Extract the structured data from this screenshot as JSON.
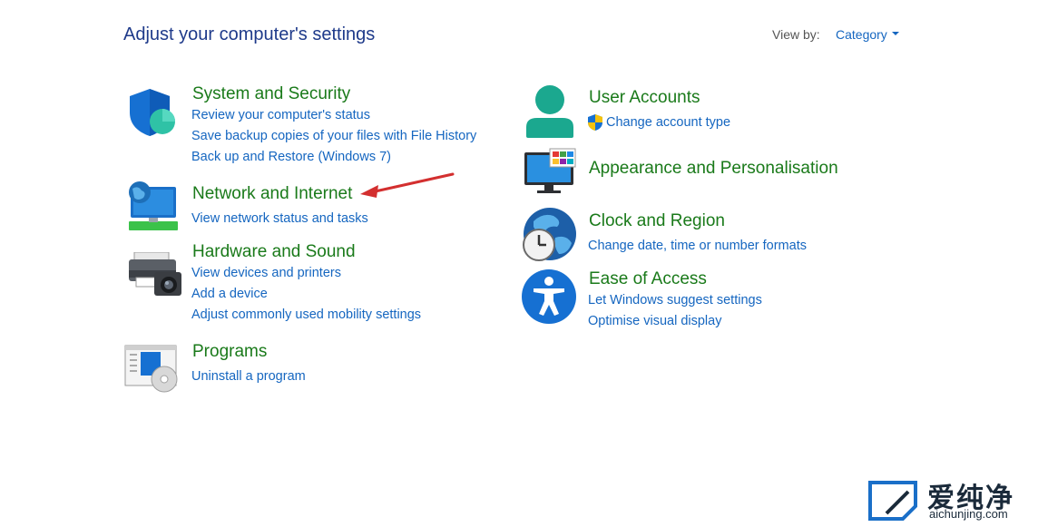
{
  "page": {
    "title": "Adjust your computer's settings",
    "view_by_label": "View by:",
    "view_by_value": "Category"
  },
  "left_categories": [
    {
      "name": "System and Security",
      "links": [
        "Review your computer's status",
        "Save backup copies of your files with File History",
        "Back up and Restore (Windows 7)"
      ]
    },
    {
      "name": "Network and Internet",
      "links": [
        "View network status and tasks"
      ]
    },
    {
      "name": "Hardware and Sound",
      "links": [
        "View devices and printers",
        "Add a device",
        "Adjust commonly used mobility settings"
      ]
    },
    {
      "name": "Programs",
      "links": [
        "Uninstall a program"
      ]
    }
  ],
  "right_categories": [
    {
      "name": "User Accounts",
      "links": [
        "Change account type"
      ]
    },
    {
      "name": "Appearance and Personalisation",
      "links": []
    },
    {
      "name": "Clock and Region",
      "links": [
        "Change date, time or number formats"
      ]
    },
    {
      "name": "Ease of Access",
      "links": [
        "Let Windows suggest settings",
        "Optimise visual display"
      ]
    }
  ],
  "watermark": {
    "cn": "爱纯净",
    "en": "aichunjing.com"
  },
  "colors": {
    "heading": "#1a7a1a",
    "link": "#1566c0",
    "title": "#1e3a8a",
    "annotation_arrow": "#d32f2f"
  }
}
